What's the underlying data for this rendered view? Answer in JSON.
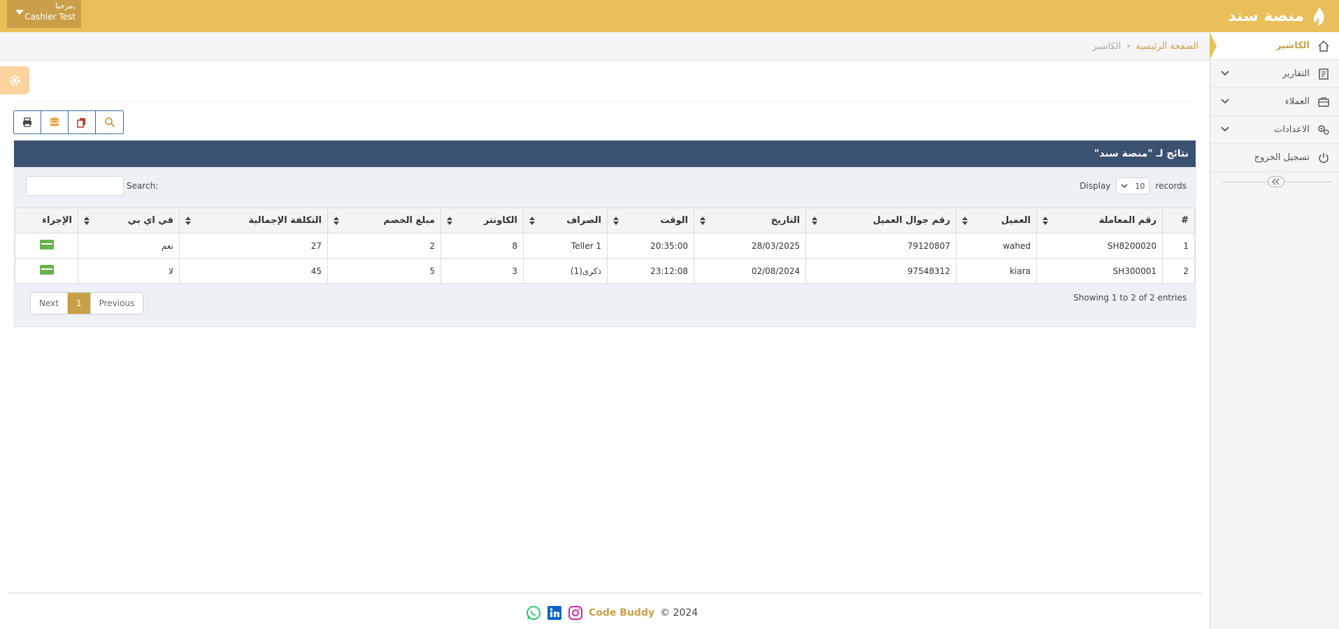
{
  "header": {
    "brand_name": "منصة سند",
    "greeting": "مرحبا,",
    "user_name": "Cashier Test"
  },
  "sidebar": {
    "items": [
      {
        "label": "الكاشير",
        "icon": "home-icon"
      },
      {
        "label": "التقارير",
        "icon": "report-icon"
      },
      {
        "label": "العملاء",
        "icon": "briefcase-icon"
      },
      {
        "label": "الاعدادات",
        "icon": "gears-icon"
      },
      {
        "label": "تسجيل الخروج",
        "icon": "power-icon"
      }
    ]
  },
  "breadcrumb": {
    "home": "الصفحة الرئيسية",
    "current": "الكاشير"
  },
  "panel": {
    "title": "نتائج لـ \"منصة سند\"",
    "records_label": "records",
    "records_value": "10",
    "display_label": "Display",
    "search_label": "Search:",
    "search_value": ""
  },
  "table": {
    "headers": [
      "#",
      "رقم المعاملة",
      "العميل",
      "رقم جوال العميل",
      "التاريخ",
      "الوقت",
      "الصراف",
      "الكاونتر",
      "مبلغ الخصم",
      "التكلفة الإجمالية",
      "في اي بي",
      "الإجراء"
    ],
    "rows": [
      {
        "idx": "1",
        "txn": "SH8200020",
        "client": "wahed",
        "phone": "79120807",
        "date": "28/03/2025",
        "time": "20:35:00",
        "teller": "Teller 1",
        "counter": "8",
        "discount": "2",
        "total": "27",
        "vip": "نعم"
      },
      {
        "idx": "2",
        "txn": "SH300001",
        "client": "kiara",
        "phone": "97548312",
        "date": "02/08/2024",
        "time": "23:12:08",
        "teller": "ذكرى(1)",
        "counter": "3",
        "discount": "5",
        "total": "45",
        "vip": "لا"
      }
    ]
  },
  "pagination": {
    "showing": "Showing 1 to 2 of 2 entries",
    "next": "Next",
    "page": "1",
    "previous": "Previous"
  },
  "footer": {
    "brand": "Code Buddy",
    "copyright": "© 2024"
  },
  "colors": {
    "accent": "#e8bf5a",
    "accent_dark": "#c9a048",
    "panel_header": "#3b5170"
  }
}
